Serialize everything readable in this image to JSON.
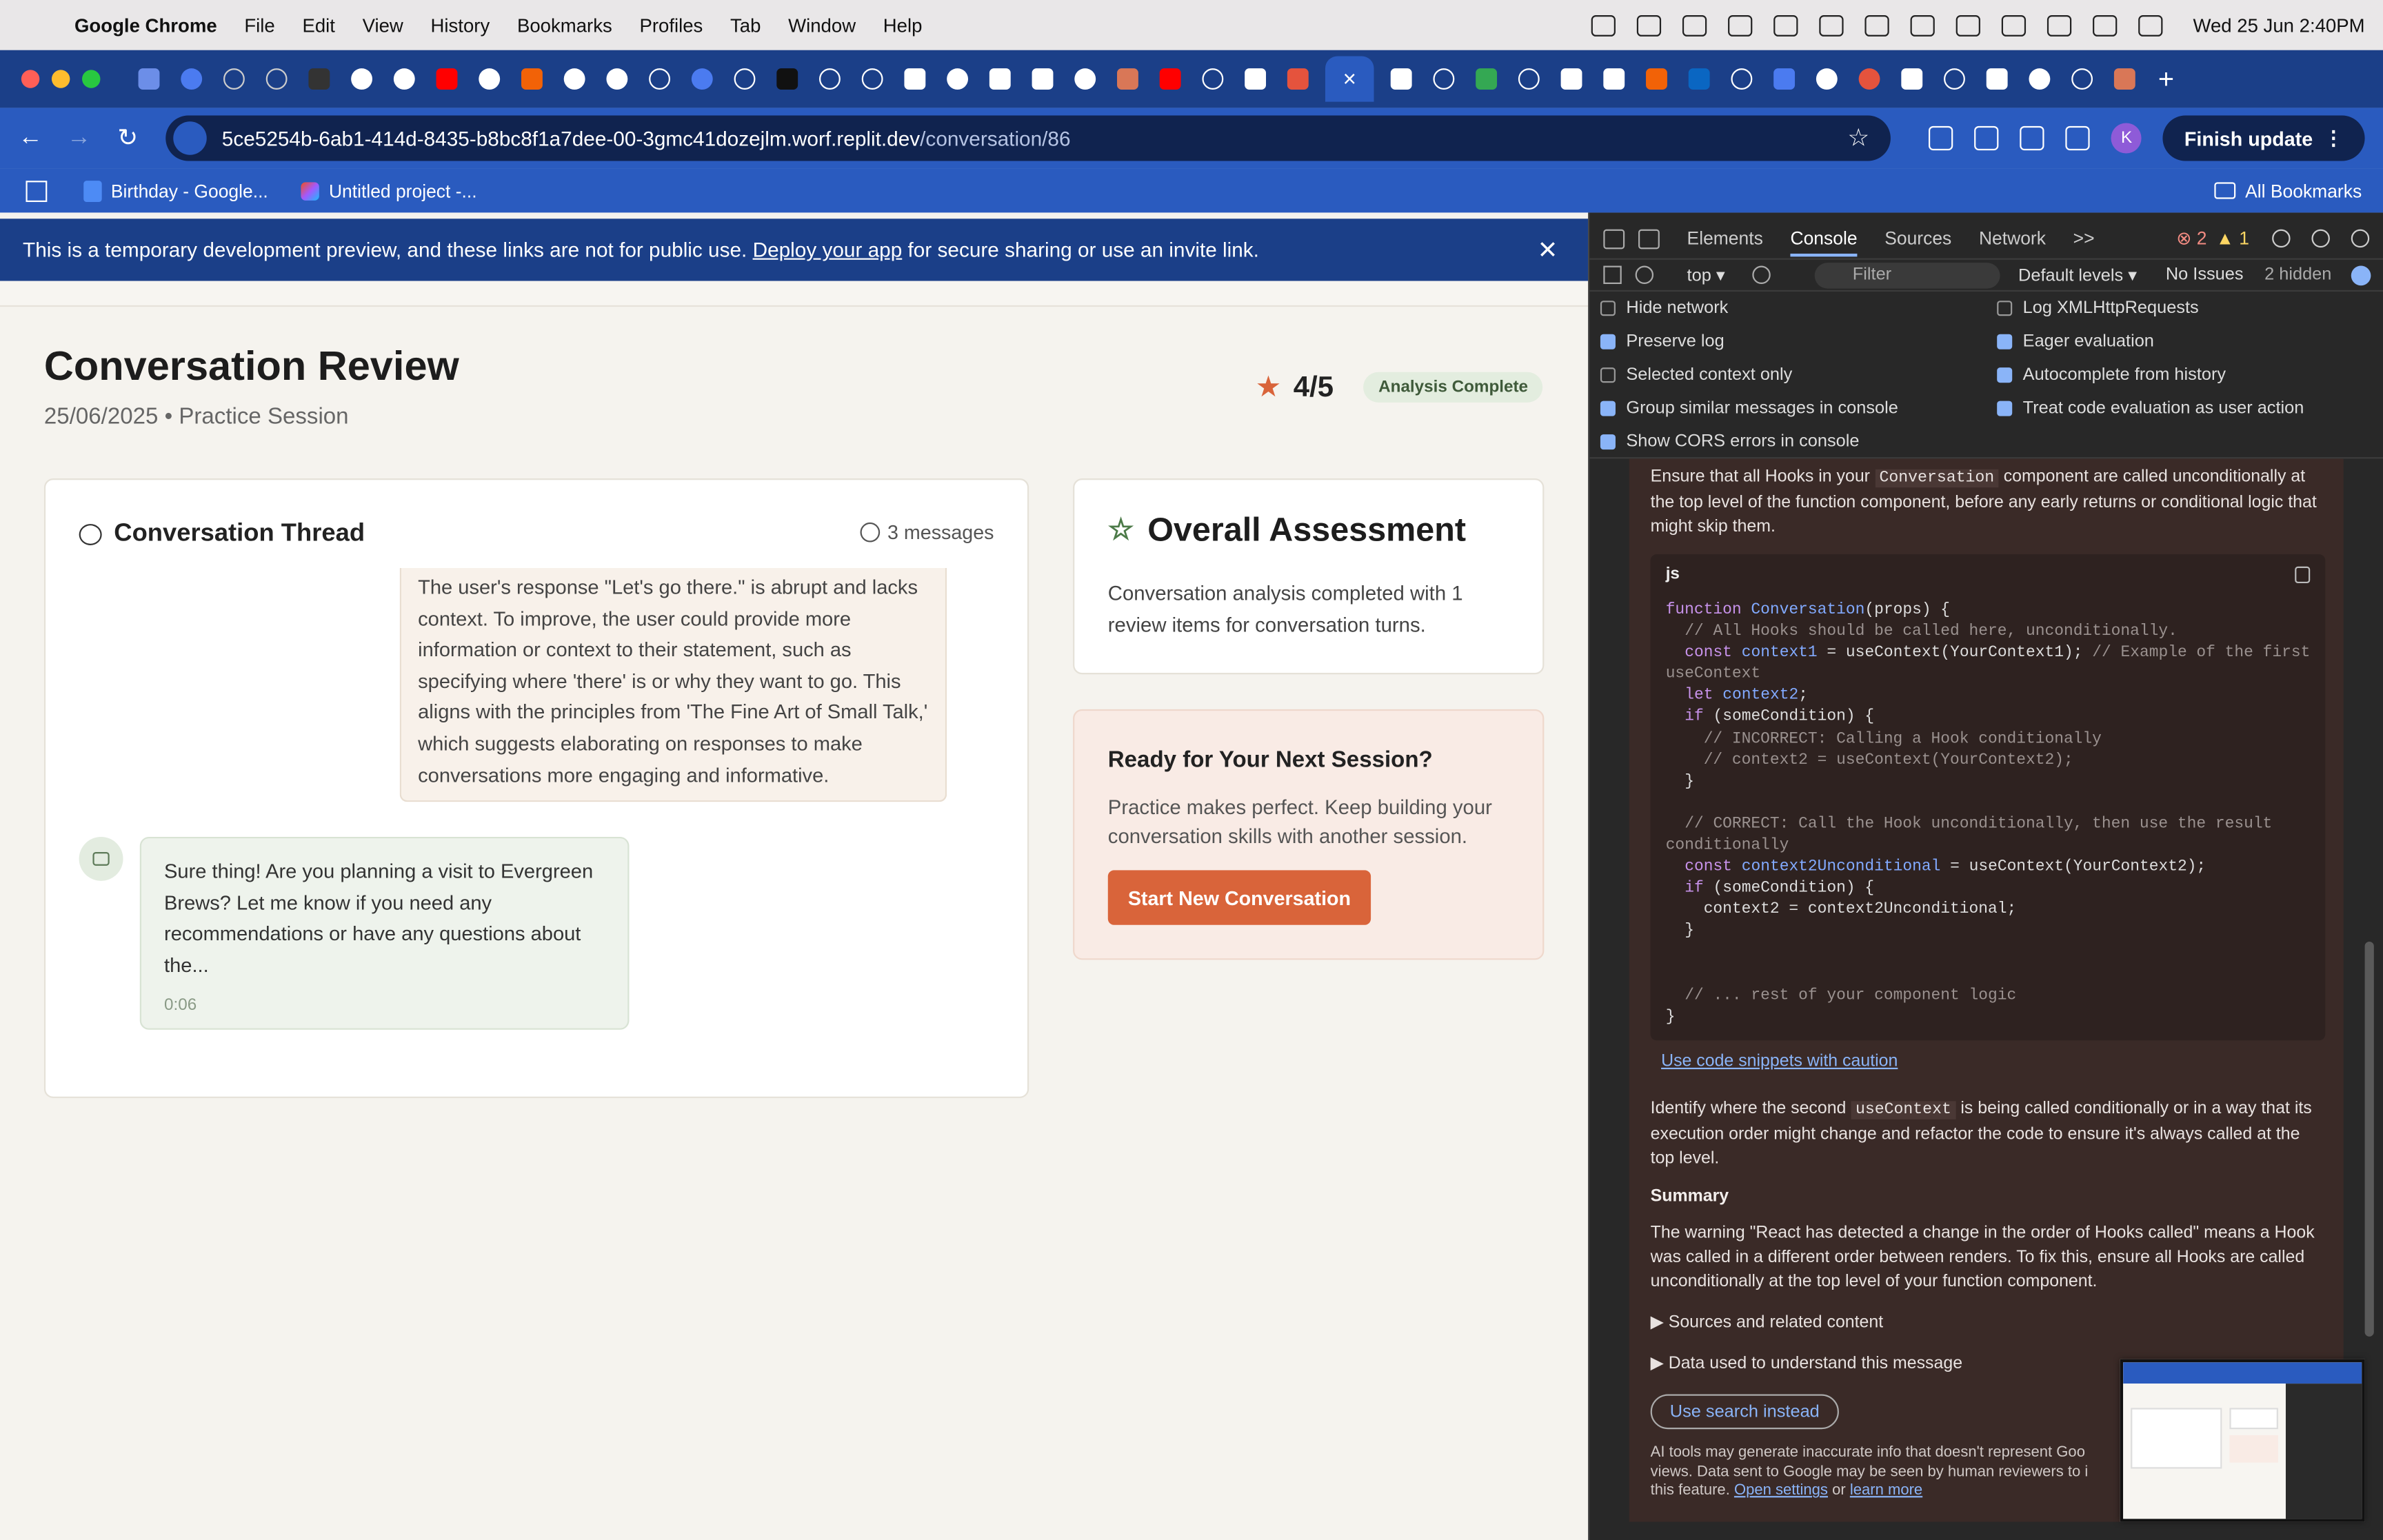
{
  "menubar": {
    "app": "Google Chrome",
    "items": [
      "File",
      "Edit",
      "View",
      "History",
      "Bookmarks",
      "Profiles",
      "Tab",
      "Window",
      "Help"
    ],
    "clock": "Wed 25 Jun  2:40PM"
  },
  "browser": {
    "url_host": "5ce5254b-6ab1-414d-8435-b8bc8f1a7dee-00-3gmc41dozejlm.worf.replit.dev",
    "url_path": "/conversation/86",
    "finish_update": "Finish update",
    "profile_initial": "K",
    "bookmarks": [
      "Birthday - Google...",
      "Untitled project -..."
    ],
    "all_bookmarks": "All Bookmarks"
  },
  "banner": {
    "text_before": "This is a temporary development preview, and these links are not for public use. ",
    "link": "Deploy your app",
    "text_after": " for secure sharing or use an invite link."
  },
  "page": {
    "title": "Conversation Review",
    "subtitle": "25/06/2025 • Practice Session",
    "score": "4/5",
    "status_badge": "Analysis Complete"
  },
  "thread": {
    "heading": "Conversation Thread",
    "count": "3 messages",
    "review_text": "The user's response \"Let's go there.\" is abrupt and lacks context. To improve, the user could provide more information or context to their statement, such as specifying where 'there' is or why they want to go. This aligns with the principles from 'The Fine Art of Small Talk,' which suggests elaborating on responses to make conversations more engaging and informative.",
    "bot_message": "Sure thing! Are you planning a visit to Evergreen Brews? Let me know if you need any recommendations or have any questions about the...",
    "bot_time": "0:06"
  },
  "assessment": {
    "heading": "Overall Assessment",
    "body": "Conversation analysis completed with 1 review items for conversation turns."
  },
  "next_session": {
    "heading": "Ready for Your Next Session?",
    "body": "Practice makes perfect. Keep building your conversation skills with another session.",
    "button": "Start New Conversation"
  },
  "devtools": {
    "tabs": [
      "Elements",
      "Console",
      "Sources",
      "Network"
    ],
    "more": ">>",
    "error_count": "2",
    "warning_count": "1",
    "context": "top ▾",
    "filter_placeholder": "Filter",
    "levels": "Default levels ▾",
    "issues": "No Issues",
    "hidden": "2 hidden",
    "settings_left": [
      {
        "label": "Hide network",
        "checked": false
      },
      {
        "label": "Preserve log",
        "checked": true
      },
      {
        "label": "Selected context only",
        "checked": false
      },
      {
        "label": "Group similar messages in console",
        "checked": true
      },
      {
        "label": "Show CORS errors in console",
        "checked": true
      }
    ],
    "settings_right": [
      {
        "label": "Log XMLHttpRequests",
        "checked": false
      },
      {
        "label": "Eager evaluation",
        "checked": true
      },
      {
        "label": "Autocomplete from history",
        "checked": true
      },
      {
        "label": "Treat code evaluation as user action",
        "checked": true
      }
    ]
  },
  "ai": {
    "p1_a": "Ensure that all Hooks in your ",
    "p1_code": "Conversation",
    "p1_b": " component are called unconditionally at the top level of the function component, before any early returns or conditional logic that might skip them.",
    "code_lang": "js",
    "caution_link": "Use code snippets with caution",
    "p2_a": "Identify where the second ",
    "p2_code": "useContext",
    "p2_b": " is being called conditionally or in a way that its execution order might change and refactor the code to ensure it's always called at the top level.",
    "summary_heading": "Summary",
    "summary": "The warning \"React has detected a change in the order of Hooks called\" means a Hook was called in a different order between renders. To fix this, ensure all Hooks are called unconditionally at the top level of your function component.",
    "sources": "▶ Sources and related content",
    "data_used": "▶ Data used to understand this message",
    "search_button": "Use search instead",
    "disclaimer_a": "AI tools may generate inaccurate info that doesn't represent Goo",
    "disclaimer_b": "views. Data sent to Google may be seen by human reviewers to i",
    "disclaimer_c": "this feature. ",
    "open_settings": "Open settings",
    "or": " or ",
    "learn_more": "learn more"
  }
}
